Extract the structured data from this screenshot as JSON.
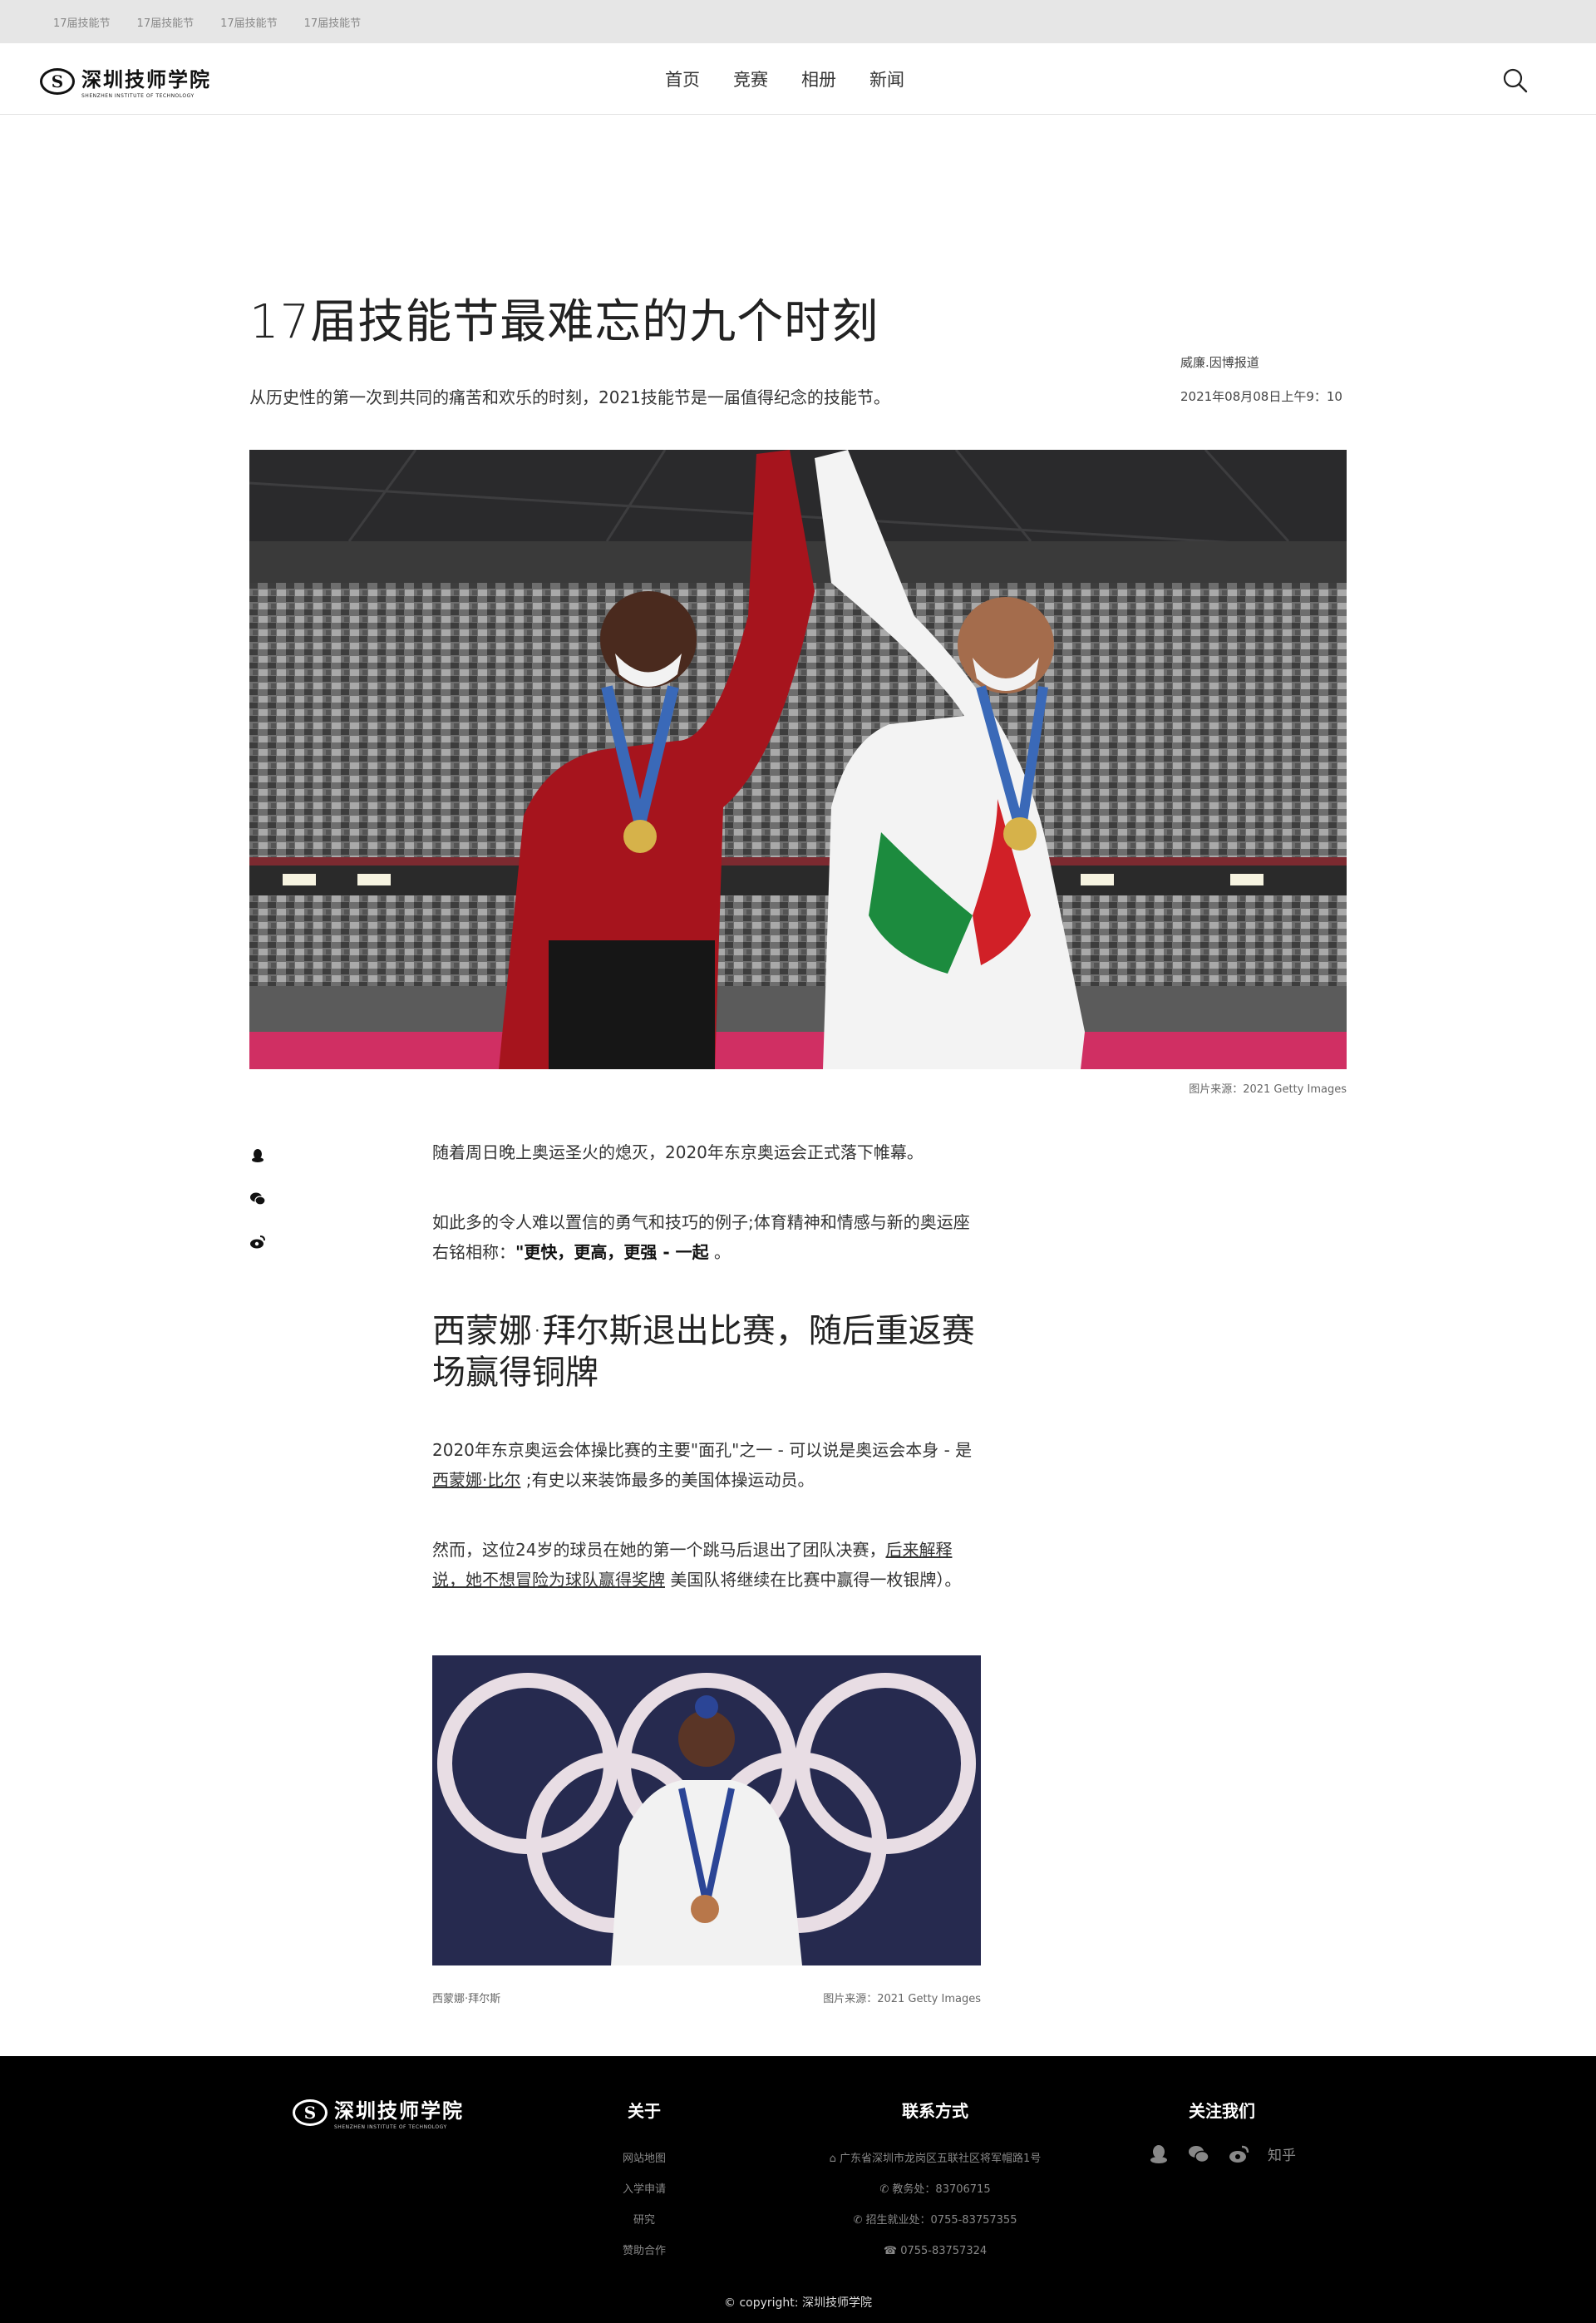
{
  "topbar": {
    "links": [
      "17届技能节",
      "17届技能节",
      "17届技能节",
      "17届技能节"
    ]
  },
  "header": {
    "logo_cn": "深圳技师学院",
    "logo_en": "SHENZHEN INSTITUTE OF TECHNOLOGY",
    "nav": [
      "首页",
      "竞赛",
      "相册",
      "新闻"
    ]
  },
  "article": {
    "title": "17届技能节最难忘的九个时刻",
    "subtitle": "从历史性的第一次到共同的痛苦和欢乐的时刻，2021技能节是一届值得纪念的技能节。",
    "byline": "威廉.因博报道",
    "date": "2021年08月08日上午9：10",
    "hero_caption": "图片来源：2021 Getty Images",
    "p1": "随着周日晚上奥运圣火的熄灭，2020年东京奥运会正式落下帷幕。",
    "p2a": "如此多的令人难以置信的勇气和技巧的例子;体育精神和情感与新的奥运座右铭相称：",
    "p2b": "\"更快，更高，更强 - 一起",
    "p2c": "。",
    "h2": "西蒙娜·拜尔斯退出比赛，随后重返赛场赢得铜牌",
    "p3a": "2020年东京奥运会体操比赛的主要\"面孔\"之一 - 可以说是奥运会本身 - 是",
    "p3link": "西蒙娜·比尔",
    "p3b": ";有史以来装饰最多的美国体操运动员。",
    "p4a": "然而，这位24岁的球员在她的第一个跳马后退出了团队决赛，",
    "p4link": "后来解释说，她不想冒险为球队赢得奖牌",
    "p4b": "美国队将继续在比赛中赢得一枚银牌）。",
    "img2_caption_left": "西蒙娜·拜尔斯",
    "img2_caption_right": "图片来源：2021 Getty Images"
  },
  "footer": {
    "about_title": "关于",
    "about_links": [
      "网站地图",
      "入学申请",
      "研究",
      "赞助合作"
    ],
    "contact_title": "联系方式",
    "contact_lines": [
      "广东省深圳市龙岗区五联社区将军帽路1号",
      "教务处：83706715",
      "招生就业处：0755-83757355",
      "0755-83757324"
    ],
    "follow_title": "关注我们",
    "zhihu": "知乎",
    "copyright": "© copyright: 深圳技师学院"
  },
  "colors": {
    "footer_bg": "#000000",
    "topbar_bg": "#e6e6e6"
  }
}
